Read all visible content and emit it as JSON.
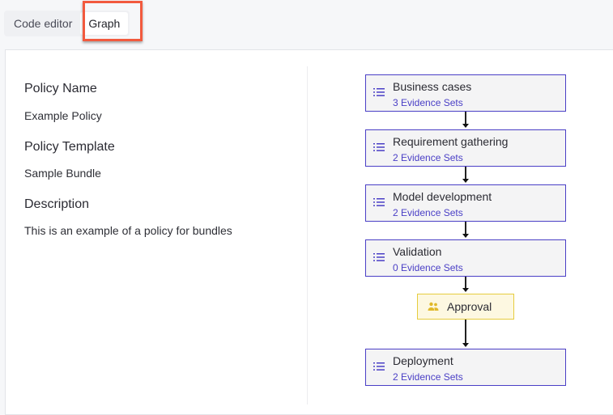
{
  "tabs": [
    {
      "label": "Code editor",
      "active": false
    },
    {
      "label": "Graph",
      "active": true
    }
  ],
  "highlight_color": "#f25a3e",
  "info": {
    "policy_name_label": "Policy Name",
    "policy_name_value": "Example Policy",
    "policy_template_label": "Policy Template",
    "policy_template_value": "Sample Bundle",
    "description_label": "Description",
    "description_value": "This is an example of a policy for bundles"
  },
  "graph": {
    "accent_color": "#4a3fc6",
    "approval_color": "#e6cc3f",
    "nodes": [
      {
        "title": "Business cases",
        "subtitle": "3 Evidence Sets",
        "icon": "list-icon"
      },
      {
        "title": "Requirement gathering",
        "subtitle": "2 Evidence Sets",
        "icon": "list-icon"
      },
      {
        "title": "Model development",
        "subtitle": "2 Evidence Sets",
        "icon": "list-icon"
      },
      {
        "title": "Validation",
        "subtitle": "0 Evidence Sets",
        "icon": "list-icon"
      },
      {
        "title": "Deployment",
        "subtitle": "2 Evidence Sets",
        "icon": "list-icon"
      }
    ],
    "approval": {
      "title": "Approval",
      "icon": "people-icon"
    }
  }
}
